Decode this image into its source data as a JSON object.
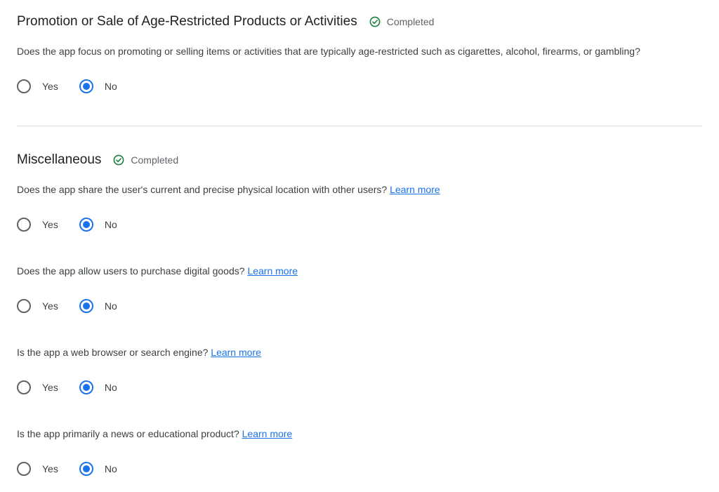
{
  "sections": [
    {
      "title": "Promotion or Sale of Age-Restricted Products or Activities",
      "status": "Completed",
      "questions": [
        {
          "text": "Does the app focus on promoting or selling items or activities that are typically age-restricted such as cigarettes, alcohol, firearms, or gambling?",
          "link": "",
          "options": [
            "Yes",
            "No"
          ],
          "selected": "No"
        }
      ]
    },
    {
      "title": "Miscellaneous",
      "status": "Completed",
      "questions": [
        {
          "text": "Does the app share the user's current and precise physical location with other users?",
          "link": "Learn more",
          "options": [
            "Yes",
            "No"
          ],
          "selected": "No"
        },
        {
          "text": "Does the app allow users to purchase digital goods?",
          "link": "Learn more",
          "options": [
            "Yes",
            "No"
          ],
          "selected": "No"
        },
        {
          "text": "Is the app a web browser or search engine?",
          "link": "Learn more",
          "options": [
            "Yes",
            "No"
          ],
          "selected": "No"
        },
        {
          "text": "Is the app primarily a news or educational product?",
          "link": "Learn more",
          "options": [
            "Yes",
            "No"
          ],
          "selected": "No"
        }
      ]
    }
  ],
  "colors": {
    "accent": "#1a73e8",
    "success": "#188038",
    "divider": "#e0e0e0"
  },
  "icons": {
    "status": "check-circle-icon"
  }
}
